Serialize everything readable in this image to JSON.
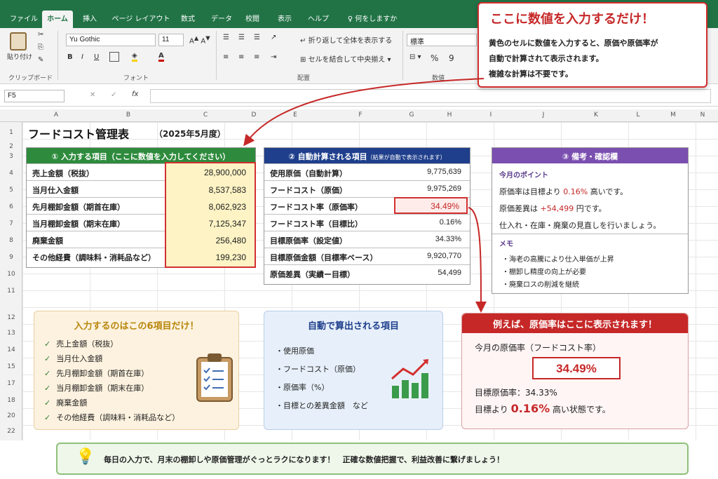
{
  "tabs": [
    "ファイル",
    "ホーム",
    "挿入",
    "ページ レイアウト",
    "数式",
    "データ",
    "校閲",
    "表示",
    "ヘルプ",
    "何をしますか"
  ],
  "ribbon": {
    "paste": "貼り付け",
    "clipboard": "クリップボード",
    "font_name": "Yu Gothic",
    "font_size": "11",
    "font_group": "フォント",
    "wrap": "折り返して全体を表示する",
    "merge": "セルを結合して中央揃え",
    "align_group": "配置",
    "number_format": "標準",
    "number_group": "数値",
    "percent": "%",
    "comma": "9"
  },
  "formula_bar": {
    "cell_ref": "F5",
    "fx": "fx"
  },
  "columns": [
    "A",
    "B",
    "C",
    "D",
    "E",
    "F",
    "G",
    "H",
    "I",
    "J",
    "K",
    "L",
    "M",
    "N"
  ],
  "rows": [
    "1",
    "2",
    "3",
    "4",
    "5",
    "6",
    "7",
    "8",
    "9",
    "10",
    "11",
    "12",
    "13",
    "14",
    "15",
    "16",
    "17",
    "18",
    "19",
    "20",
    "21",
    "22"
  ],
  "sheet": {
    "title": "フードコスト管理表",
    "period": "（2025年5月度）",
    "input": {
      "header": "① 入力する項目（ここに数値を入力してください）",
      "rows": [
        {
          "label": "売上金額（税抜）",
          "value": "28,900,000"
        },
        {
          "label": "当月仕入金額",
          "value": "8,537,583"
        },
        {
          "label": "先月棚卸金額（期首在庫）",
          "value": "8,062,923"
        },
        {
          "label": "当月棚卸金額（期末在庫）",
          "value": "7,125,347"
        },
        {
          "label": "廃棄金額",
          "value": "256,480"
        },
        {
          "label": "その他経費（調味料・消耗品など）",
          "value": "199,230"
        }
      ]
    },
    "auto": {
      "header": "② 自動計算される項目",
      "header_note": "（結果が自動で表示されます）",
      "rows": [
        {
          "label": "使用原価（自動計算）",
          "value": "9,775,639"
        },
        {
          "label": "フードコスト（原価）",
          "value": "9,975,269"
        },
        {
          "label": "フードコスト率（原価率）",
          "value": "34.49%"
        },
        {
          "label": "フードコスト率（目標比）",
          "value": "0.16%"
        },
        {
          "label": "目標原価率（設定値）",
          "value": "34.33%"
        },
        {
          "label": "目標原価金額（目標率ベース）",
          "value": "9,920,770"
        },
        {
          "label": "原価差異（実績ー目標）",
          "value": "54,499"
        }
      ]
    },
    "notes": {
      "header": "③ 備考・確認欄",
      "point_title": "今月のポイント",
      "line1_a": "原価率は目標より",
      "line1_b": "0.16%",
      "line1_c": "高いです。",
      "line2_a": "原価差異は",
      "line2_b": "+54,499",
      "line2_c": "円です。",
      "line3": "仕入れ・在庫・廃棄の見直しを行いましょう。",
      "memo_title": "メモ",
      "memo": [
        "・海老の高騰により仕入単価が上昇",
        "・棚卸し精度の向上が必要",
        "・廃棄ロスの削減を継続"
      ]
    }
  },
  "callout": {
    "title": "ここに数値を入力するだけ！",
    "body": [
      "黄色のセルに数値を入力すると、原価や原価率が",
      "自動で計算されて表示されます。",
      "複雑な計算は不要です。"
    ]
  },
  "card1": {
    "title": "入力するのはこの6項目だけ！",
    "items": [
      "売上金額（税抜）",
      "当月仕入金額",
      "先月棚卸金額（期首在庫）",
      "当月棚卸金額（期末在庫）",
      "廃棄金額",
      "その他経費（調味料・消耗品など）"
    ]
  },
  "card2": {
    "title": "自動で算出される項目",
    "items": [
      "・使用原価",
      "・フードコスト（原価）",
      "・原価率（%）",
      "・目標との差異金額　など"
    ]
  },
  "card3": {
    "title": "例えば、原価率はここに表示されます！",
    "label": "今月の原価率（フードコスト率）",
    "value": "34.49%",
    "target": "目標原価率：34.33%",
    "diff_a": "目標より",
    "diff_b": "0.16%",
    "diff_c": "高い状態です。"
  },
  "banner": {
    "text": "毎日の入力で、月末の棚卸しや原価管理がぐっとラクになります！　正確な数値把握で、利益改善に繋げましょう！"
  },
  "colors": {
    "excel_green": "#217346",
    "input_header": "#2e8b3d",
    "auto_header": "#1f3f8c",
    "notes_header": "#7b4fb0",
    "input_fill": "#fdf3c4",
    "accent_red": "#c62828"
  }
}
